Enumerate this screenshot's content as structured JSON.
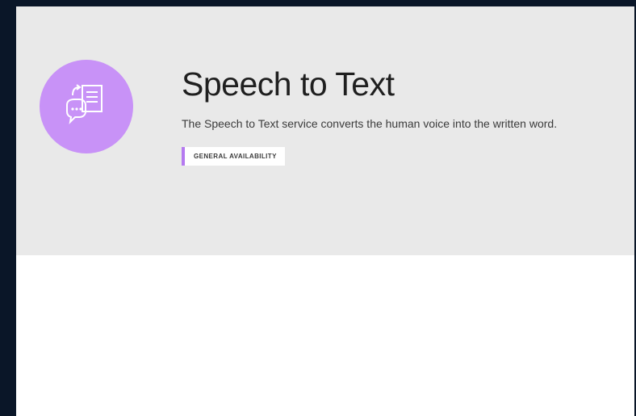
{
  "service": {
    "title": "Speech to Text",
    "description": "The Speech to Text service converts the human voice into the written word.",
    "status_badge": "GENERAL AVAILABILITY"
  },
  "colors": {
    "accent": "#c892f7",
    "badge_border": "#b57af0",
    "hero_background": "#e9e9e9",
    "page_background": "#0a1628"
  },
  "icons": {
    "service_icon": "speech-to-text-icon"
  }
}
